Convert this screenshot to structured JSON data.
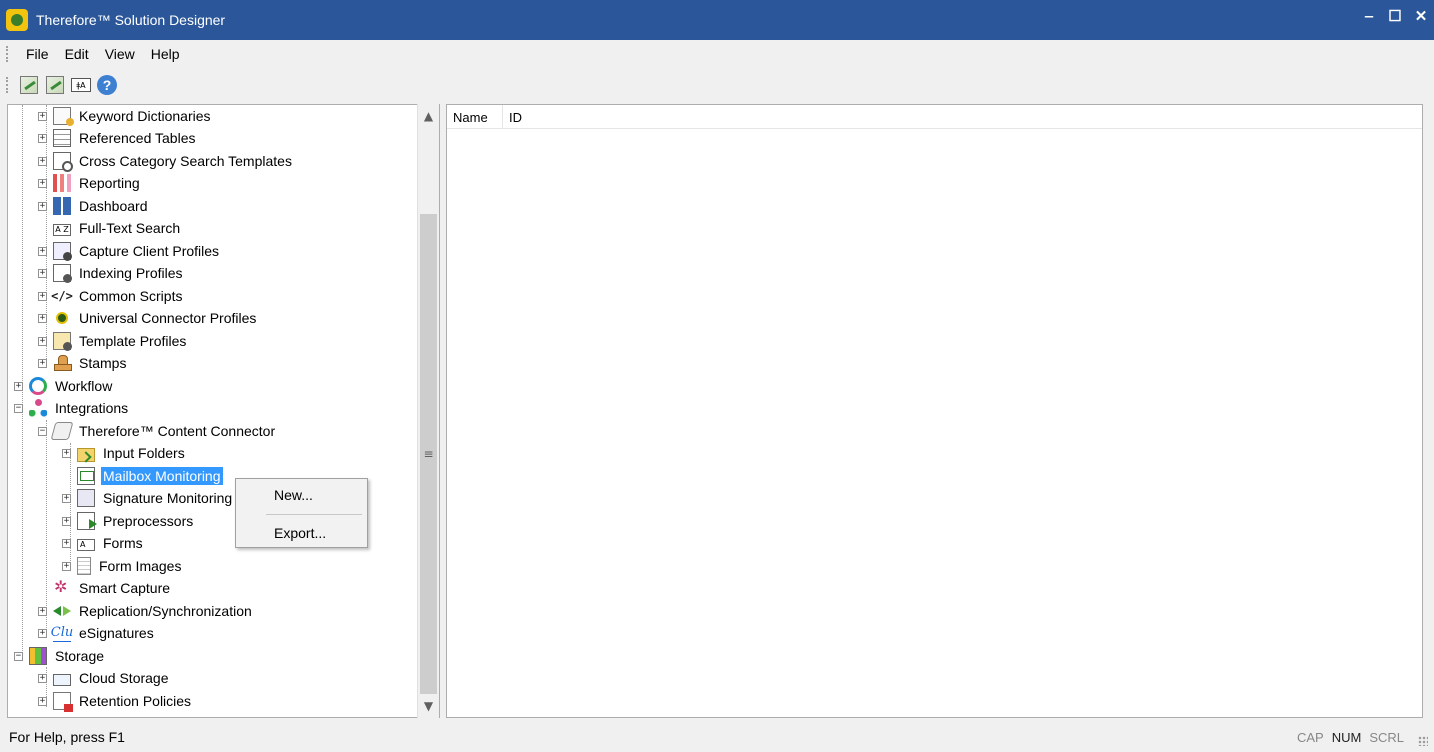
{
  "window": {
    "title": "Therefore™ Solution Designer",
    "controls": {
      "minimize": "‒",
      "maximize": "☐",
      "close": "✕"
    }
  },
  "menubar": {
    "items": [
      "File",
      "Edit",
      "View",
      "Help"
    ]
  },
  "toolbar": {
    "buttons": [
      {
        "icon": "designer-icon"
      },
      {
        "icon": "designer-alt-icon"
      },
      {
        "icon": "fulltext-icon",
        "text": "ǂA"
      },
      {
        "icon": "help-icon",
        "text": "?"
      }
    ]
  },
  "tree": {
    "items": [
      {
        "label": "Keyword Dictionaries",
        "level": 1,
        "expander": "+",
        "icon": "keyword-dictionary-icon"
      },
      {
        "label": "Referenced Tables",
        "level": 1,
        "expander": "+",
        "icon": "table-icon"
      },
      {
        "label": "Cross Category Search Templates",
        "level": 1,
        "expander": "+",
        "icon": "search-template-icon"
      },
      {
        "label": "Reporting",
        "level": 1,
        "expander": "+",
        "icon": "report-icon"
      },
      {
        "label": "Dashboard",
        "level": 1,
        "expander": "+",
        "icon": "dashboard-icon"
      },
      {
        "label": "Full-Text Search",
        "level": 1,
        "expander": "",
        "icon": "fulltext-search-icon",
        "icon_text": "A Z"
      },
      {
        "label": "Capture Client Profiles",
        "level": 1,
        "expander": "+",
        "icon": "capture-profile-icon"
      },
      {
        "label": "Indexing Profiles",
        "level": 1,
        "expander": "+",
        "icon": "indexing-profile-icon"
      },
      {
        "label": "Common Scripts",
        "level": 1,
        "expander": "+",
        "icon": "script-icon",
        "icon_text": "</>"
      },
      {
        "label": "Universal Connector Profiles",
        "level": 1,
        "expander": "+",
        "icon": "connector-profile-icon"
      },
      {
        "label": "Template Profiles",
        "level": 1,
        "expander": "+",
        "icon": "template-profile-icon"
      },
      {
        "label": "Stamps",
        "level": 1,
        "expander": "+",
        "icon": "stamp-icon"
      },
      {
        "label": "Workflow",
        "level": 0,
        "expander": "+",
        "icon": "workflow-icon"
      },
      {
        "label": "Integrations",
        "level": 0,
        "expander": "−",
        "icon": "integrations-icon"
      },
      {
        "label": "Therefore™ Content Connector",
        "level": 1,
        "expander": "−",
        "icon": "content-connector-icon"
      },
      {
        "label": "Input Folders",
        "level": 2,
        "expander": "+",
        "icon": "input-folder-icon"
      },
      {
        "label": "Mailbox Monitoring",
        "level": 2,
        "expander": "",
        "icon": "mailbox-icon",
        "selected": true
      },
      {
        "label": "Signature Monitoring",
        "level": 2,
        "expander": "+",
        "icon": "signature-icon"
      },
      {
        "label": "Preprocessors",
        "level": 2,
        "expander": "+",
        "icon": "preprocessor-icon"
      },
      {
        "label": "Forms",
        "level": 2,
        "expander": "+",
        "icon": "forms-icon",
        "icon_text": "A"
      },
      {
        "label": "Form Images",
        "level": 2,
        "expander": "+",
        "icon": "form-image-icon"
      },
      {
        "label": "Smart Capture",
        "level": 1,
        "expander": "",
        "icon": "smart-capture-icon"
      },
      {
        "label": "Replication/Synchronization",
        "level": 1,
        "expander": "+",
        "icon": "replication-icon"
      },
      {
        "label": "eSignatures",
        "level": 1,
        "expander": "+",
        "icon": "esignature-icon",
        "icon_text": "Clu"
      },
      {
        "label": "Storage",
        "level": 0,
        "expander": "−",
        "icon": "storage-icon"
      },
      {
        "label": "Cloud Storage",
        "level": 1,
        "expander": "+",
        "icon": "cloud-storage-icon"
      },
      {
        "label": "Retention Policies",
        "level": 1,
        "expander": "+",
        "icon": "retention-policy-icon"
      }
    ]
  },
  "scrollbar": {
    "up": "▲",
    "down": "▼",
    "grip": "≡"
  },
  "list": {
    "columns": [
      "Name",
      "ID"
    ],
    "rows": []
  },
  "context_menu": {
    "items": [
      "New...",
      "Export..."
    ]
  },
  "statusbar": {
    "text": "For Help, press F1",
    "indicators": [
      {
        "label": "CAP",
        "active": false
      },
      {
        "label": "NUM",
        "active": true
      },
      {
        "label": "SCRL",
        "active": false
      }
    ]
  },
  "colors": {
    "titlebar": "#2b579a",
    "selection": "#3399ff",
    "background": "#f0f0f0"
  }
}
